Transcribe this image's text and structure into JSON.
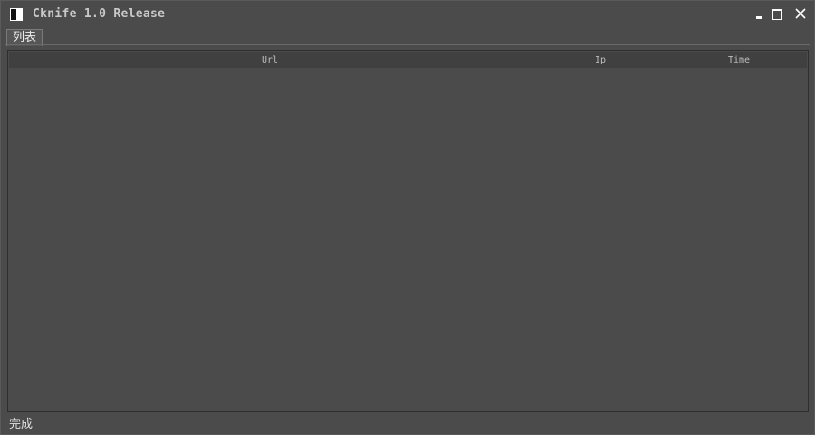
{
  "window": {
    "title": "Cknife 1.0 Release",
    "icon": "app-icon"
  },
  "tabs": [
    {
      "label": "列表",
      "active": true
    }
  ],
  "table": {
    "columns": [
      "Url",
      "Ip",
      "Time"
    ],
    "rows": []
  },
  "status": {
    "text": "完成"
  },
  "colors": {
    "background": "#4b4b4b",
    "header": "#404040",
    "text": "#d8d8d8"
  }
}
